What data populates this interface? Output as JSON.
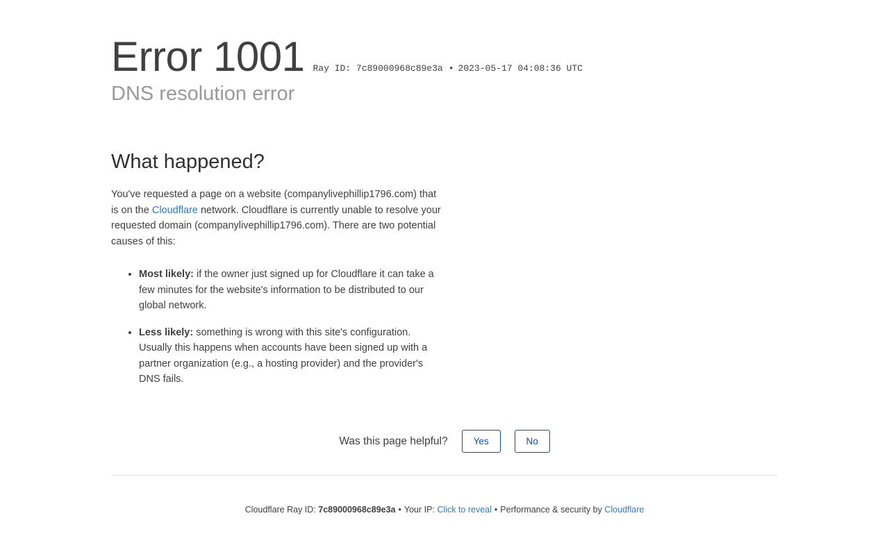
{
  "header": {
    "error_code": "Error 1001",
    "ray_label": "Ray ID: 7c89000968c89e3a",
    "separator": "•",
    "timestamp": "2023-05-17 04:08:36 UTC",
    "subtitle": "DNS resolution error"
  },
  "what_happened": {
    "heading": "What happened?",
    "para_before_link": "You've requested a page on a website (companylivephillip1796.com) that is on the ",
    "link_text": "Cloudflare",
    "para_after_link": " network. Cloudflare is currently unable to resolve your requested domain (companylivephillip1796.com). There are two potential causes of this:",
    "causes": [
      {
        "label": "Most likely:",
        "text": " if the owner just signed up for Cloudflare it can take a few minutes for the website's information to be distributed to our global network."
      },
      {
        "label": "Less likely:",
        "text": " something is wrong with this site's configuration. Usually this happens when accounts have been signed up with a partner organization (e.g., a hosting provider) and the provider's DNS fails."
      }
    ]
  },
  "feedback": {
    "question": "Was this page helpful?",
    "yes_label": "Yes",
    "no_label": "No"
  },
  "footer": {
    "ray_prefix": "Cloudflare Ray ID: ",
    "ray_id": "7c89000968c89e3a",
    "sep1": "•",
    "ip_prefix": "Your IP: ",
    "ip_link": "Click to reveal",
    "sep2": "•",
    "perf_prefix": "Performance & security by ",
    "cloudflare_link": "Cloudflare"
  },
  "colors": {
    "link": "#2f7bbf",
    "button_accent": "#0051c3",
    "subtitle": "#999999",
    "text": "#404040"
  }
}
